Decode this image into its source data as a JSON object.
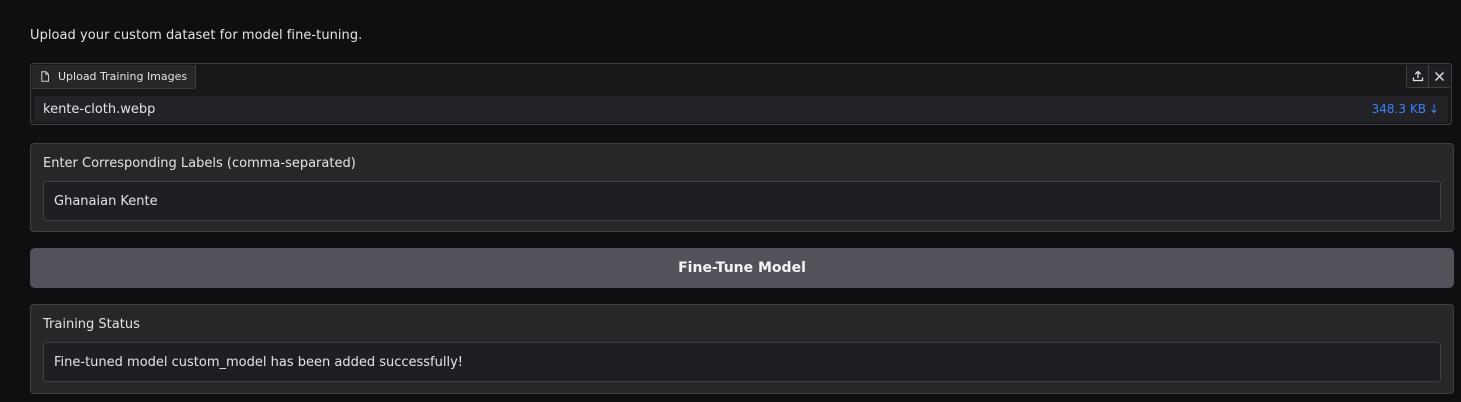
{
  "intro_text": "Upload your custom dataset for model fine-tuning.",
  "upload": {
    "label": "Upload Training Images",
    "file_name": "kente-cloth.webp",
    "file_size": "348.3 KB",
    "download_glyph": "↓"
  },
  "labels_panel": {
    "title": "Enter Corresponding Labels (comma-separated)",
    "value": "Ghanaian Kente"
  },
  "fine_tune_button": {
    "label": "Fine-Tune Model"
  },
  "status_panel": {
    "title": "Training Status",
    "value": "Fine-tuned model custom_model has been added successfully!"
  },
  "icons": {
    "file": "file-icon",
    "upload": "upload-icon",
    "close": "close-icon",
    "download": "download-icon"
  },
  "colors": {
    "background": "#0f0f11",
    "panel": "#27272a",
    "button": "#52525b",
    "link": "#3b82f6"
  }
}
